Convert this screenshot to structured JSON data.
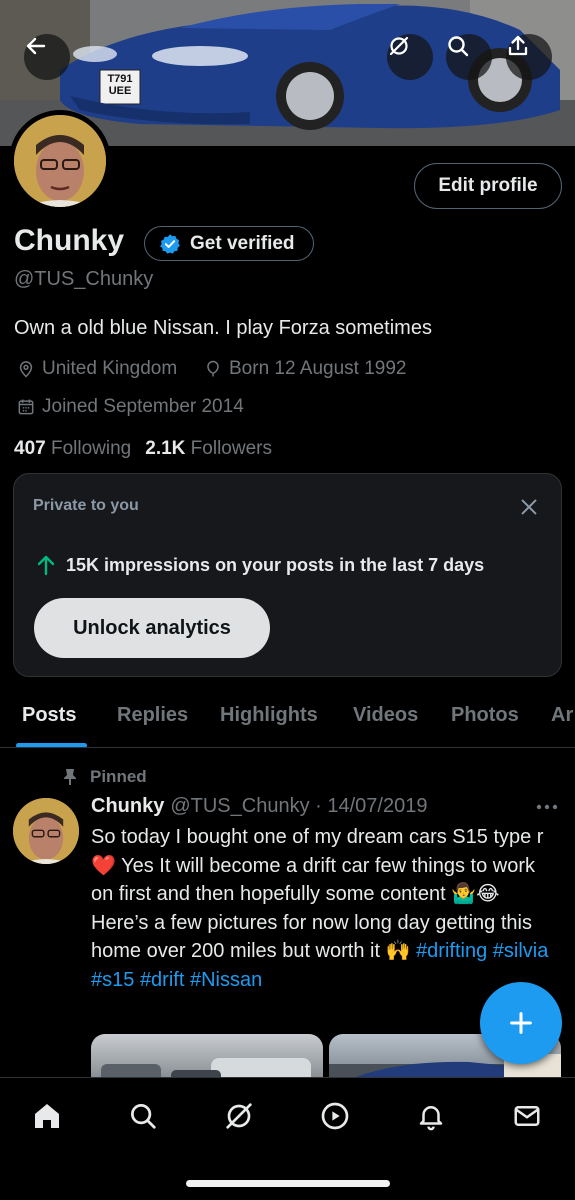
{
  "header": {
    "license_plate": "T791 UEE",
    "icons": [
      "back-icon",
      "grok-icon",
      "search-icon",
      "share-icon"
    ]
  },
  "profile": {
    "name": "Chunky",
    "get_verified_label": "Get verified",
    "handle": "@TUS_Chunky",
    "edit_profile_label": "Edit profile",
    "bio": "Own a old blue Nissan. I play Forza sometimes",
    "location": "United Kingdom",
    "birthday": "Born 12 August 1992",
    "joined": "Joined September 2014",
    "following_count": "407",
    "following_label": "Following",
    "followers_count": "2.1K",
    "followers_label": "Followers"
  },
  "analytics": {
    "private_label": "Private to you",
    "impressions_text": "15K impressions on your posts in the last 7 days",
    "unlock_label": "Unlock analytics"
  },
  "tabs": [
    {
      "label": "Posts",
      "active": true
    },
    {
      "label": "Replies"
    },
    {
      "label": "Highlights"
    },
    {
      "label": "Videos"
    },
    {
      "label": "Photos"
    },
    {
      "label": "Ar"
    }
  ],
  "post": {
    "pinned_label": "Pinned",
    "author": "Chunky",
    "handle_date": "@TUS_Chunky · 14/07/2019",
    "text_1": "So today I bought one of my dream cars S15 type r",
    "emoji_heart": "❤️",
    "text_2": " Yes It will become a drift car few things to work on first and then hopefully some content",
    "emoji_shrug": "🤷‍♂️",
    "emoji_laugh": "😂",
    "text_3": " Here’s a few pictures for now long day getting this home over 200 miles but worth it",
    "emoji_hands": "🙌",
    "hashtags": [
      "#drifting",
      "#silvia",
      "#s15",
      "#drift",
      "#Nissan"
    ]
  },
  "bottom_nav": [
    "home-icon",
    "search-icon",
    "grok-icon",
    "video-icon",
    "notifications-icon",
    "messages-icon"
  ],
  "colors": {
    "accent": "#1d9bf0",
    "background": "#000000",
    "text_primary": "#e7e9ea",
    "text_secondary": "#71767b",
    "impressions_arrow": "#00ba7c",
    "car_blue": "#1f3e8a"
  }
}
